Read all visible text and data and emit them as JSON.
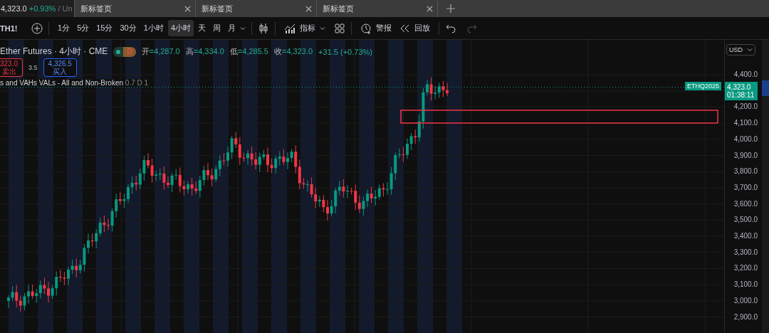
{
  "tabs": [
    {
      "label": "4,323.0",
      "change": "+0.93%",
      "rest": "/ Un",
      "selected": true
    },
    {
      "label": "新标签页",
      "selected": false
    },
    {
      "label": "新标签页",
      "selected": false
    },
    {
      "label": "新标签页",
      "selected": false
    }
  ],
  "toolbar": {
    "symbol": "TH1!",
    "intervals": [
      {
        "label": "1分",
        "selected": false
      },
      {
        "label": "5分",
        "selected": false
      },
      {
        "label": "15分",
        "selected": false
      },
      {
        "label": "30分",
        "selected": false
      },
      {
        "label": "1小时",
        "selected": false
      },
      {
        "label": "4小时",
        "selected": true
      },
      {
        "label": "天",
        "selected": false
      },
      {
        "label": "周",
        "selected": false
      },
      {
        "label": "月",
        "selected": false
      }
    ],
    "indicators": "指标",
    "alerts": "警报",
    "replay": "回放"
  },
  "legend": {
    "title": "Ether Futures · 4小时 · CME",
    "badge": "D",
    "ohlc": [
      {
        "label": "开",
        "value": "=4,287.0"
      },
      {
        "label": "高",
        "value": "=4,334.0"
      },
      {
        "label": "低",
        "value": "=4,285.5"
      },
      {
        "label": "收",
        "value": "=4,323.0"
      }
    ],
    "change": "+31.5 (+0.73%)"
  },
  "trade": {
    "sell_price": "323.0",
    "sell_label": "卖出",
    "spread": "3.5",
    "buy_price": "4,326.5",
    "buy_label": "买入"
  },
  "indicator": {
    "name": "s and VAHs VALs - All and Non-Broken",
    "params": "0.7 D 1"
  },
  "price_axis": {
    "currency": "USD",
    "ticks": [
      "4,400.0",
      "4,200.0",
      "4,100.0",
      "4,000.0",
      "3,900.0",
      "3,800.0",
      "3,700.0",
      "3,600.0",
      "3,500.0",
      "3,400.0",
      "3,300.0",
      "3,200.0",
      "3,100.0",
      "3,000.0",
      "2,900.0"
    ],
    "symbol_label": "ETHQ2025",
    "last_price": "4,323.0",
    "countdown": "01:38:11"
  }
}
